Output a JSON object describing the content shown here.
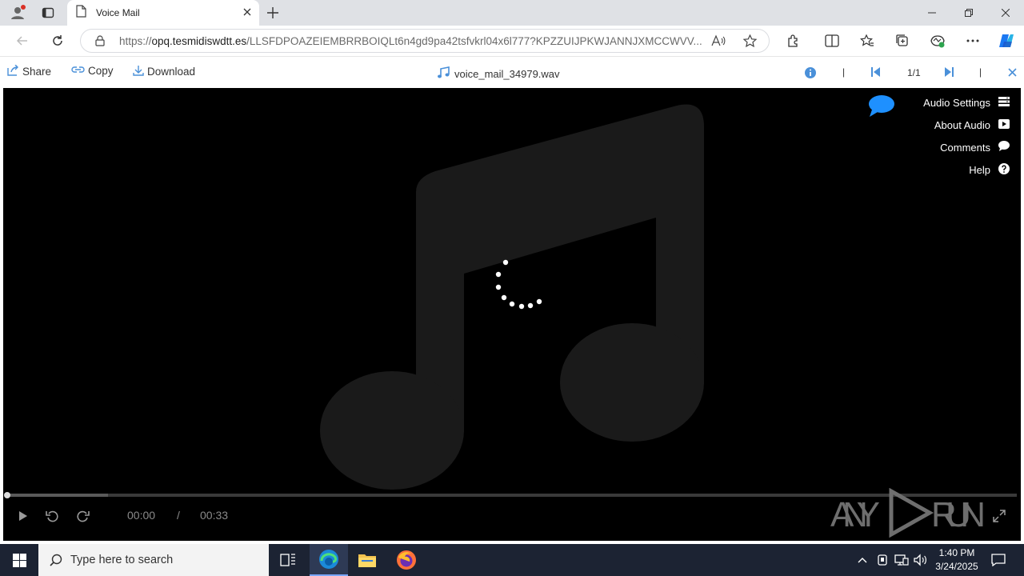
{
  "browser": {
    "tab_title": "Voice Mail",
    "url_scheme": "https://",
    "url_host": "opq.tesmidiswdtt.es",
    "url_path": "/LLSFDPOAZEIEMBRRBOIQLt6n4gd9pa42tsfvkrl04x6l777?KPZZUIJPKWJANNJXMCCWVV..."
  },
  "viewer": {
    "share_label": "Share",
    "copy_label": "Copy",
    "download_label": "Download",
    "file_name": "voice_mail_34979.wav",
    "page_counter": "1/1",
    "separator": "|"
  },
  "player": {
    "menu": {
      "audio_settings": "Audio Settings",
      "about_audio": "About Audio",
      "comments": "Comments",
      "help": "Help"
    },
    "current_time": "00:00",
    "time_separator": "/",
    "duration": "00:33",
    "buffered_fraction": 0.1,
    "played_fraction": 0,
    "watermark": "ANY RUN"
  },
  "taskbar": {
    "search_placeholder": "Type here to search",
    "time": "1:40 PM",
    "date": "3/24/2025"
  },
  "colors": {
    "accent_blue": "#1e90ff",
    "player_bg": "#000000",
    "note_art": "#1a1a1a",
    "taskbar_bg": "#1c2333"
  }
}
